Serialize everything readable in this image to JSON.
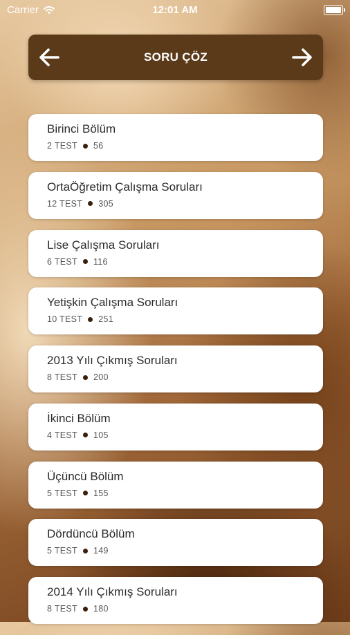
{
  "status_bar": {
    "carrier": "Carrier",
    "time": "12:01 AM"
  },
  "header": {
    "title": "SORU ÇÖZ",
    "back_icon": "arrow-left-icon",
    "forward_icon": "arrow-right-icon",
    "background_color": "#5a3a18"
  },
  "colors": {
    "dot": "#3a200c",
    "card_background": "#ffffff"
  },
  "items": [
    {
      "title": "Birinci Bölüm",
      "tests": "2 TEST",
      "count": "56"
    },
    {
      "title": "OrtaÖğretim Çalışma Soruları",
      "tests": "12 TEST",
      "count": "305"
    },
    {
      "title": "Lise Çalışma Soruları",
      "tests": "6 TEST",
      "count": "116"
    },
    {
      "title": "Yetişkin Çalışma Soruları",
      "tests": "10 TEST",
      "count": "251"
    },
    {
      "title": "2013 Yılı Çıkmış Soruları",
      "tests": "8 TEST",
      "count": "200"
    },
    {
      "title": "İkinci Bölüm",
      "tests": "4 TEST",
      "count": "105"
    },
    {
      "title": "Üçüncü Bölüm",
      "tests": "5 TEST",
      "count": "155"
    },
    {
      "title": "Dördüncü Bölüm",
      "tests": "5 TEST",
      "count": "149"
    },
    {
      "title": "2014 Yılı Çıkmış Soruları",
      "tests": "8 TEST",
      "count": "180"
    }
  ]
}
